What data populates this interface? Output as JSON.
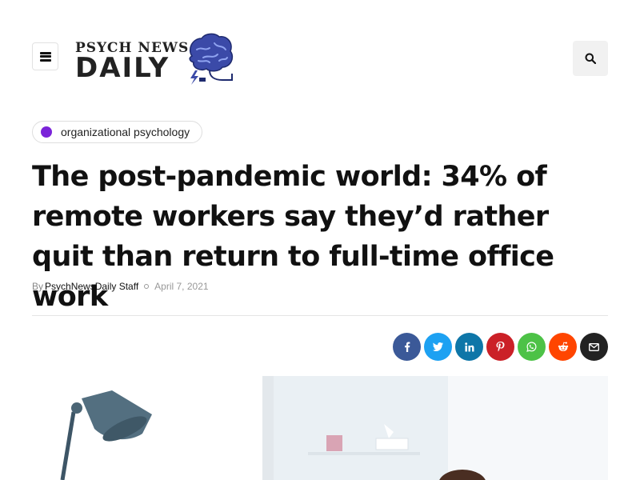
{
  "header": {
    "logo_line1": "PSYCH NEWS",
    "logo_line2": "DAILY",
    "menu_icon": "bars-icon",
    "search_icon": "search-icon"
  },
  "article": {
    "category": "organizational psychology",
    "category_color": "#7b24d9",
    "title": "The post-pandemic world: 34% of remote workers say they’d rather quit than return to full-time office work",
    "by_label": "By",
    "author": "PsychNewsDaily Staff",
    "date": "April 7, 2021"
  },
  "share": [
    {
      "name": "facebook",
      "icon": "facebook-icon",
      "color": "#3b5998"
    },
    {
      "name": "twitter",
      "icon": "twitter-icon",
      "color": "#1da1f2"
    },
    {
      "name": "linkedin",
      "icon": "linkedin-icon",
      "color": "#0e76a8"
    },
    {
      "name": "pinterest",
      "icon": "pinterest-icon",
      "color": "#cb2027"
    },
    {
      "name": "whatsapp",
      "icon": "whatsapp-icon",
      "color": "#4dc247"
    },
    {
      "name": "reddit",
      "icon": "reddit-icon",
      "color": "#ff4500"
    },
    {
      "name": "email",
      "icon": "envelope-icon",
      "color": "#222222"
    }
  ]
}
